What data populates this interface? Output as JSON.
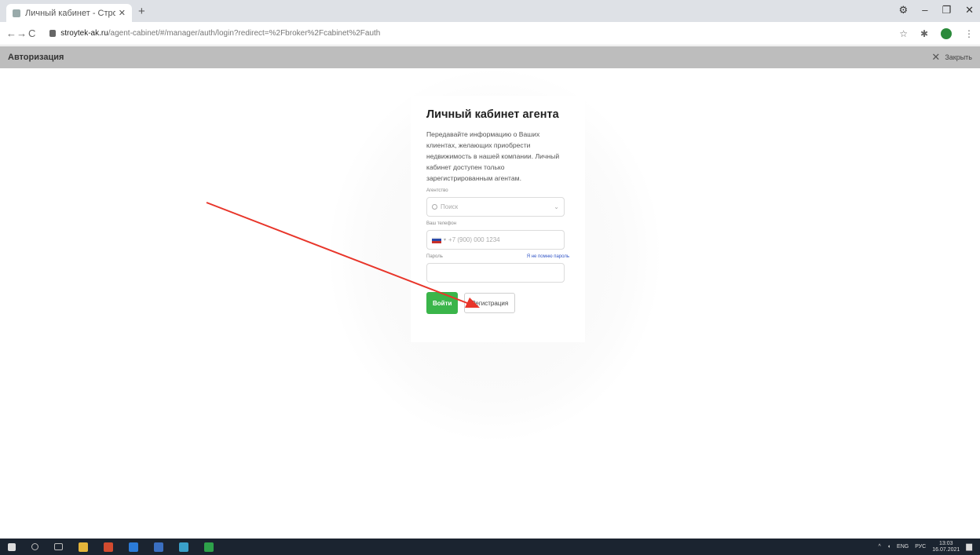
{
  "browser": {
    "tab_title": "Личный кабинет - Стройтех",
    "new_tab": "+",
    "window_controls": [
      "⚙",
      "–",
      "❐",
      "✕"
    ],
    "nav": [
      "←",
      "→",
      "C"
    ],
    "url_host": "stroytek-ak.ru",
    "url_path": "/agent-cabinet/#/manager/auth/login?redirect=%2Fbroker%2Fcabinet%2Fauth"
  },
  "app_header": {
    "title": "Авторизация",
    "close_label": "Закрыть"
  },
  "card": {
    "title": "Личный кабинет агента",
    "description": "Передавайте информацию о Ваших клиентах, желающих приобрести недвижимость в нашей компании. Личный кабинет доступен только зарегистрированным агентам.",
    "agency_label": "Агентство",
    "agency_placeholder": "Поиск",
    "phone_label": "Ваш телефон",
    "phone_placeholder": "+7 (900) 000 1234",
    "password_label": "Пароль",
    "forgot_link": "Я не помню пароль",
    "login_button": "Войти",
    "register_button": "Регистрация"
  },
  "annotation": {
    "color": "#e8352a"
  },
  "taskbar": {
    "tray_lang": "ENG",
    "tray_layout": "РУС",
    "time": "13:03",
    "date": "16.07.2021"
  }
}
